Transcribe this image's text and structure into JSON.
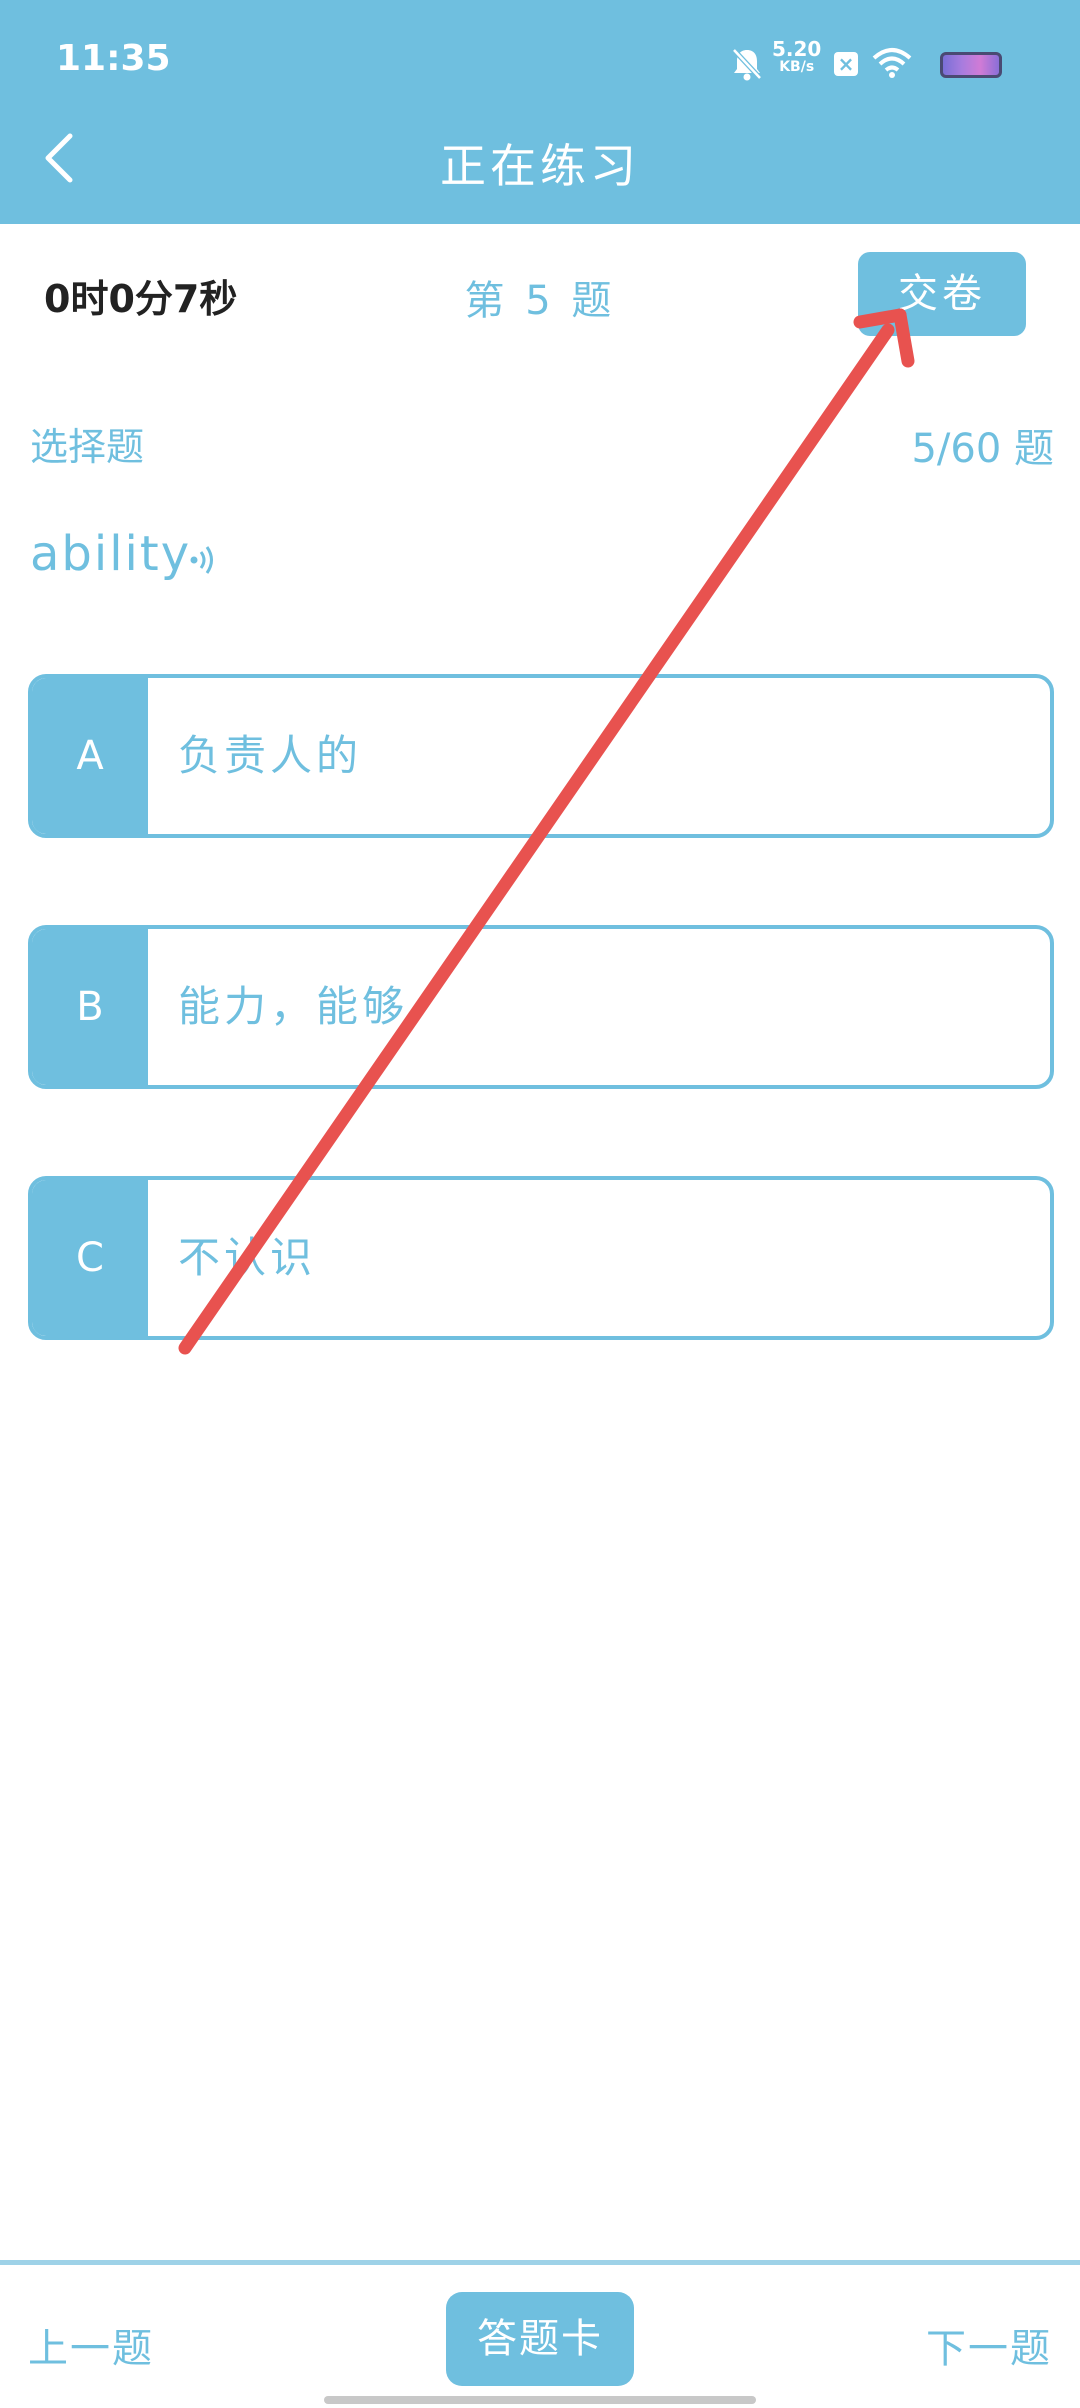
{
  "status_bar": {
    "time": "11:35",
    "net_speed": "5.20",
    "net_unit": "KB/s",
    "icons": [
      "bell-muted-icon",
      "x-box-icon",
      "wifi-icon",
      "battery-icon"
    ]
  },
  "header": {
    "title": "正在练习"
  },
  "toolbar": {
    "timer": "0时0分7秒",
    "question_number": "第 5 题",
    "submit_label": "交卷"
  },
  "question": {
    "type": "选择题",
    "progress": "5/60 题",
    "word": "ability",
    "options": [
      {
        "letter": "A",
        "text": "负责人的"
      },
      {
        "letter": "B",
        "text": "能力，能够"
      },
      {
        "letter": "C",
        "text": "不认识"
      }
    ]
  },
  "footer": {
    "prev_label": "上一题",
    "card_label": "答题卡",
    "next_label": "下一题"
  },
  "colors": {
    "primary": "#6fbfdf",
    "annotation_arrow": "#e8524f"
  }
}
